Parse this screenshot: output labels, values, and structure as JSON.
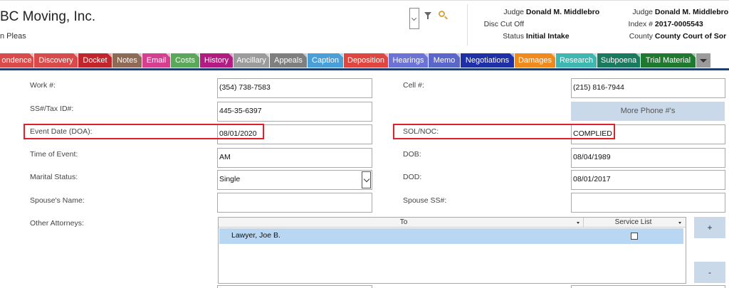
{
  "header": {
    "company": "BC Moving, Inc.",
    "subtitle": "n Pleas",
    "col1": [
      {
        "label": "Judge",
        "value": "Donald M. Middlebro"
      },
      {
        "label": "Disc Cut Off",
        "value": ""
      },
      {
        "label": "Status",
        "value": "Initial Intake"
      }
    ],
    "col2": [
      {
        "label": "Judge",
        "value": "Donald M. Middlebro"
      },
      {
        "label": "Index #",
        "value": "2017-0005543"
      },
      {
        "label": "County",
        "value": "County Court of Sor"
      }
    ]
  },
  "tabs": [
    {
      "label": "ondence",
      "color": "#d94b4b"
    },
    {
      "label": "Discovery",
      "color": "#d94b4b"
    },
    {
      "label": "Docket",
      "color": "#c0262b"
    },
    {
      "label": "Notes",
      "color": "#8e6a57"
    },
    {
      "label": "Email",
      "color": "#d63f8f"
    },
    {
      "label": "Costs",
      "color": "#5aa85a"
    },
    {
      "label": "History",
      "color": "#b41b82"
    },
    {
      "label": "Ancillary",
      "color": "#9b9b9b"
    },
    {
      "label": "Appeals",
      "color": "#7f7f7f"
    },
    {
      "label": "Caption",
      "color": "#4a9fd8"
    },
    {
      "label": "Deposition",
      "color": "#e0453f"
    },
    {
      "label": "Hearings",
      "color": "#6b73d6"
    },
    {
      "label": "Memo",
      "color": "#5a66c9"
    },
    {
      "label": "Negotiations",
      "color": "#1f2fa8"
    },
    {
      "label": "Damages",
      "color": "#f08a1c"
    },
    {
      "label": "Research",
      "color": "#3fb7b1"
    },
    {
      "label": "Subpoena",
      "color": "#1a7a5e"
    },
    {
      "label": "Trial Material",
      "color": "#1f7a2f"
    }
  ],
  "form": {
    "work": {
      "label": "Work #:",
      "value": "(354) 738-7583"
    },
    "cell": {
      "label": "Cell #:",
      "value": "(215) 816-7944"
    },
    "ssn": {
      "label": "SS#/Tax ID#:",
      "value": "445-35-6397"
    },
    "more_phone": "More Phone #'s",
    "event_date": {
      "label": "Event Date (DOA):",
      "value": "08/01/2020"
    },
    "sol": {
      "label": "SOL/NOC:",
      "value": "COMPLIED"
    },
    "time_event": {
      "label": "Time of Event:",
      "value": "AM"
    },
    "dob": {
      "label": "DOB:",
      "value": "08/04/1989"
    },
    "marital": {
      "label": "Marital Status:",
      "value": "Single"
    },
    "dod": {
      "label": "DOD:",
      "value": "08/01/2017"
    },
    "spouse_name": {
      "label": "Spouse's Name:",
      "value": ""
    },
    "spouse_ss": {
      "label": "Spouse SS#:",
      "value": ""
    },
    "other_attorneys": {
      "label": "Other Attorneys:"
    }
  },
  "grid": {
    "col_to": "To",
    "col_service": "Service List",
    "rows": [
      {
        "to": "Lawyer, Joe B.",
        "service": false
      }
    ],
    "add_label": "+",
    "remove_label": "-"
  }
}
